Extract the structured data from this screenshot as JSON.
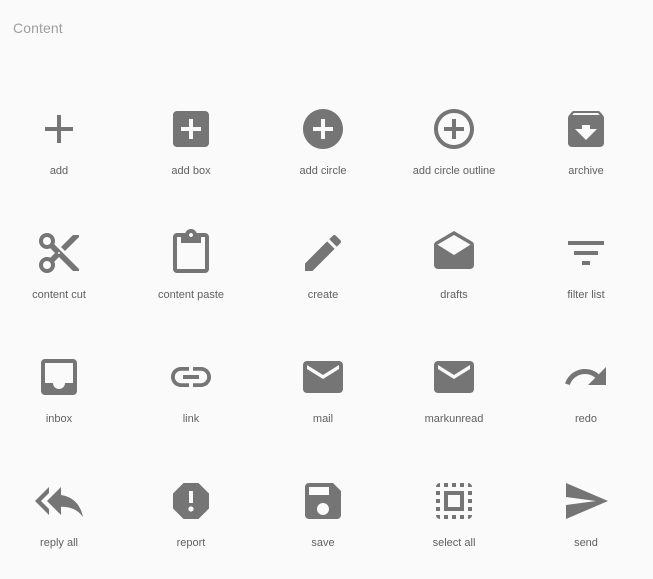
{
  "section": {
    "title": "Content"
  },
  "icons": [
    {
      "label": "add",
      "icon": "add-icon"
    },
    {
      "label": "add box",
      "icon": "add-box-icon"
    },
    {
      "label": "add circle",
      "icon": "add-circle-icon"
    },
    {
      "label": "add circle outline",
      "icon": "add-circle-outline-icon"
    },
    {
      "label": "archive",
      "icon": "archive-icon"
    },
    {
      "label": "content cut",
      "icon": "content-cut-icon"
    },
    {
      "label": "content paste",
      "icon": "content-paste-icon"
    },
    {
      "label": "create",
      "icon": "create-icon"
    },
    {
      "label": "drafts",
      "icon": "drafts-icon"
    },
    {
      "label": "filter list",
      "icon": "filter-list-icon"
    },
    {
      "label": "inbox",
      "icon": "inbox-icon"
    },
    {
      "label": "link",
      "icon": "link-icon"
    },
    {
      "label": "mail",
      "icon": "mail-icon"
    },
    {
      "label": "markunread",
      "icon": "markunread-icon"
    },
    {
      "label": "redo",
      "icon": "redo-icon"
    },
    {
      "label": "reply all",
      "icon": "reply-all-icon"
    },
    {
      "label": "report",
      "icon": "report-icon"
    },
    {
      "label": "save",
      "icon": "save-icon"
    },
    {
      "label": "select all",
      "icon": "select-all-icon"
    },
    {
      "label": "send",
      "icon": "send-icon"
    }
  ],
  "colors": {
    "icon": "#757575",
    "label": "#616161",
    "title": "#9e9e9e",
    "background": "#fafafa"
  }
}
